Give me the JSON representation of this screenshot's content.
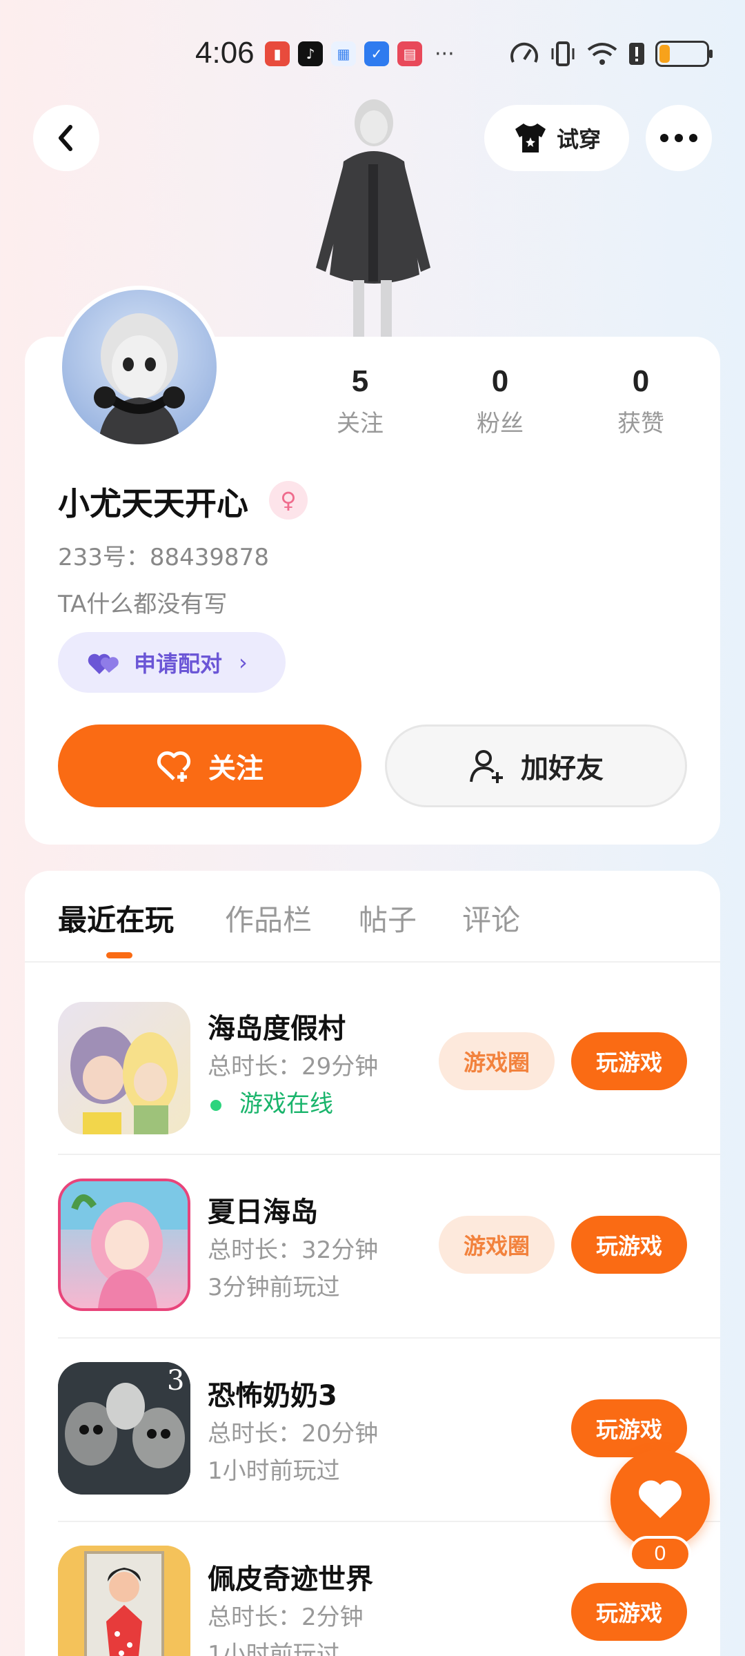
{
  "status_bar": {
    "time": "4:06",
    "more": "···",
    "battery_level": 0.22,
    "battery_color": "#f7a21b"
  },
  "header": {
    "back_icon": "chevron-left-icon",
    "tryon_label": "试穿",
    "tryon_icon": "tshirt-icon",
    "more_icon": "more-horizontal-icon"
  },
  "profile": {
    "stats": [
      {
        "value": "5",
        "label": "关注"
      },
      {
        "value": "0",
        "label": "粉丝"
      },
      {
        "value": "0",
        "label": "获赞"
      }
    ],
    "username": "小尤天天开心",
    "gender": "female",
    "user_id": "233号：88439878",
    "bio": "TA什么都没有写",
    "pair_label": "申请配对",
    "follow_label": "关注",
    "add_friend_label": "加好友"
  },
  "tabs": [
    {
      "label": "最近在玩",
      "active": true
    },
    {
      "label": "作品栏",
      "active": false
    },
    {
      "label": "帖子",
      "active": false
    },
    {
      "label": "评论",
      "active": false
    }
  ],
  "games": [
    {
      "title": "海岛度假村",
      "time": "总时长：29分钟",
      "status": "游戏在线",
      "online": true,
      "circle_label": "游戏圈",
      "play_label": "玩游戏"
    },
    {
      "title": "夏日海岛",
      "time": "总时长：32分钟",
      "status": "3分钟前玩过",
      "online": false,
      "circle_label": "游戏圈",
      "play_label": "玩游戏"
    },
    {
      "title": "恐怖奶奶3",
      "time": "总时长：20分钟",
      "status": "1小时前玩过",
      "online": false,
      "play_label": "玩游戏"
    },
    {
      "title": "佩皮奇迹世界",
      "time": "总时长：2分钟",
      "status": "1小时前玩过",
      "online": false,
      "play_label": "玩游戏"
    }
  ],
  "fab": {
    "count": "0"
  },
  "colors": {
    "accent": "#fa6b14",
    "online": "#19b46b",
    "pair": "#6b56d6"
  }
}
